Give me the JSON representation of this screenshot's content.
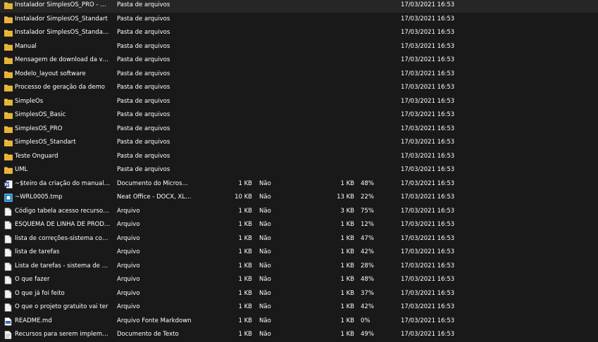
{
  "files": [
    {
      "name": "Instalador SimplesOS_PRO - Demo...",
      "type": "Pasta de arquivos",
      "size": "",
      "encrypted": "",
      "compressed": "",
      "ratio": "",
      "modified": "17/03/2021 16:53",
      "icon": "folder-icon"
    },
    {
      "name": "Instalador SimplesOS_Standart",
      "type": "Pasta de arquivos",
      "size": "",
      "encrypted": "",
      "compressed": "",
      "ratio": "",
      "modified": "17/03/2021 16:53",
      "icon": "folder-icon"
    },
    {
      "name": "Instalador SimplesOS_Standart - De...",
      "type": "Pasta de arquivos",
      "size": "",
      "encrypted": "",
      "compressed": "",
      "ratio": "",
      "modified": "17/03/2021 16:53",
      "icon": "folder-icon"
    },
    {
      "name": "Manual",
      "type": "Pasta de arquivos",
      "size": "",
      "encrypted": "",
      "compressed": "",
      "ratio": "",
      "modified": "17/03/2021 16:53",
      "icon": "folder-icon"
    },
    {
      "name": "Mensagem de download da versão...",
      "type": "Pasta de arquivos",
      "size": "",
      "encrypted": "",
      "compressed": "",
      "ratio": "",
      "modified": "17/03/2021 16:53",
      "icon": "folder-icon"
    },
    {
      "name": "Modelo_layout software",
      "type": "Pasta de arquivos",
      "size": "",
      "encrypted": "",
      "compressed": "",
      "ratio": "",
      "modified": "17/03/2021 16:53",
      "icon": "folder-icon"
    },
    {
      "name": "Processo de geração da demo",
      "type": "Pasta de arquivos",
      "size": "",
      "encrypted": "",
      "compressed": "",
      "ratio": "",
      "modified": "17/03/2021 16:53",
      "icon": "folder-icon"
    },
    {
      "name": "SimpleOs",
      "type": "Pasta de arquivos",
      "size": "",
      "encrypted": "",
      "compressed": "",
      "ratio": "",
      "modified": "17/03/2021 16:53",
      "icon": "folder-icon"
    },
    {
      "name": "SimplesOS_Basic",
      "type": "Pasta de arquivos",
      "size": "",
      "encrypted": "",
      "compressed": "",
      "ratio": "",
      "modified": "17/03/2021 16:53",
      "icon": "folder-icon"
    },
    {
      "name": "SimplesOS_PRO",
      "type": "Pasta de arquivos",
      "size": "",
      "encrypted": "",
      "compressed": "",
      "ratio": "",
      "modified": "17/03/2021 16:53",
      "icon": "folder-icon"
    },
    {
      "name": "SimplesOS_Standart",
      "type": "Pasta de arquivos",
      "size": "",
      "encrypted": "",
      "compressed": "",
      "ratio": "",
      "modified": "17/03/2021 16:53",
      "icon": "folder-icon"
    },
    {
      "name": "Teste Onguard",
      "type": "Pasta de arquivos",
      "size": "",
      "encrypted": "",
      "compressed": "",
      "ratio": "",
      "modified": "17/03/2021 16:53",
      "icon": "folder-icon"
    },
    {
      "name": "UML",
      "type": "Pasta de arquivos",
      "size": "",
      "encrypted": "",
      "compressed": "",
      "ratio": "",
      "modified": "17/03/2021 16:53",
      "icon": "folder-icon"
    },
    {
      "name": "~$teiro da criação do manual.docx",
      "type": "Documento do Microsoft ...",
      "size": "1 KB",
      "encrypted": "Não",
      "compressed": "1 KB",
      "ratio": "48%",
      "modified": "17/03/2021 16:53",
      "icon": "word-document-icon"
    },
    {
      "name": "~WRL0005.tmp",
      "type": "Neat Office - DOCX, XLSX...",
      "size": "10 KB",
      "encrypted": "Não",
      "compressed": "13 KB",
      "ratio": "22%",
      "modified": "17/03/2021 16:53",
      "icon": "neat-office-icon"
    },
    {
      "name": "Código tabela acesso recursos fun...",
      "type": "Arquivo",
      "size": "1 KB",
      "encrypted": "Não",
      "compressed": "3 KB",
      "ratio": "75%",
      "modified": "17/03/2021 16:53",
      "icon": "file-icon"
    },
    {
      "name": "ESQUEMA DE LINHA DE PRODUTOS",
      "type": "Arquivo",
      "size": "1 KB",
      "encrypted": "Não",
      "compressed": "1 KB",
      "ratio": "12%",
      "modified": "17/03/2021 16:53",
      "icon": "file-icon"
    },
    {
      "name": "lista de correções-sistema controle...",
      "type": "Arquivo",
      "size": "1 KB",
      "encrypted": "Não",
      "compressed": "1 KB",
      "ratio": "47%",
      "modified": "17/03/2021 16:53",
      "icon": "file-icon"
    },
    {
      "name": "lista de tarefas",
      "type": "Arquivo",
      "size": "1 KB",
      "encrypted": "Não",
      "compressed": "1 KB",
      "ratio": "42%",
      "modified": "17/03/2021 16:53",
      "icon": "file-icon"
    },
    {
      "name": "Lista de tarefas - sistema de contro...",
      "type": "Arquivo",
      "size": "1 KB",
      "encrypted": "Não",
      "compressed": "1 KB",
      "ratio": "28%",
      "modified": "17/03/2021 16:53",
      "icon": "file-icon"
    },
    {
      "name": "O que fazer",
      "type": "Arquivo",
      "size": "1 KB",
      "encrypted": "Não",
      "compressed": "1 KB",
      "ratio": "48%",
      "modified": "17/03/2021 16:53",
      "icon": "file-icon"
    },
    {
      "name": "O que já foi feito",
      "type": "Arquivo",
      "size": "1 KB",
      "encrypted": "Não",
      "compressed": "1 KB",
      "ratio": "37%",
      "modified": "17/03/2021 16:53",
      "icon": "file-icon"
    },
    {
      "name": "O que o projeto gratuito vai ter",
      "type": "Arquivo",
      "size": "1 KB",
      "encrypted": "Não",
      "compressed": "1 KB",
      "ratio": "42%",
      "modified": "17/03/2021 16:53",
      "icon": "file-icon"
    },
    {
      "name": "README.md",
      "type": "Arquivo Fonte Markdown",
      "size": "1 KB",
      "encrypted": "Não",
      "compressed": "1 KB",
      "ratio": "0%",
      "modified": "17/03/2021 16:53",
      "icon": "markdown-file-icon"
    },
    {
      "name": "Recursos para serem implementad...",
      "type": "Documento de Texto",
      "size": "1 KB",
      "encrypted": "Não",
      "compressed": "1 KB",
      "ratio": "49%",
      "modified": "17/03/2021 16:53",
      "icon": "text-document-icon"
    }
  ],
  "colors": {
    "background": "#191919",
    "text": "#ffffff",
    "folder": "#f4c242",
    "file": "#f2f2f2",
    "word": "#2b5797",
    "neat": "#4aa3df"
  }
}
